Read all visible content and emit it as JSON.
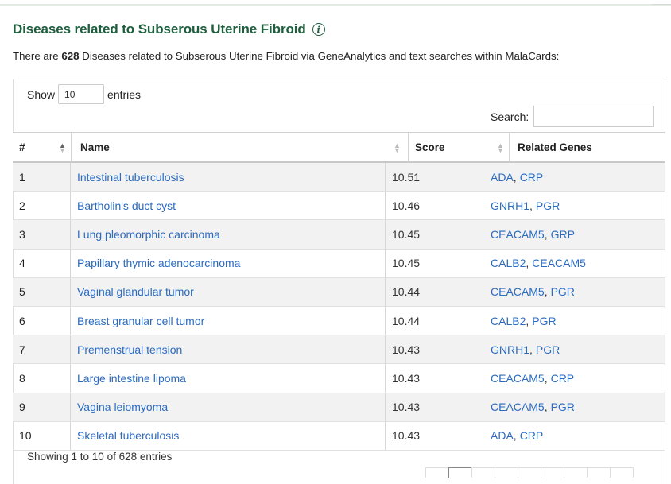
{
  "section": {
    "title": "Diseases related to Subserous Uterine Fibroid",
    "summary_pre": "There are ",
    "summary_count": "628",
    "summary_post": " Diseases related to Subserous Uterine Fibroid via GeneAnalytics and text searches within MalaCards:"
  },
  "controls": {
    "show_label": "Show",
    "entries_value": "10",
    "entries_label": "entries",
    "search_label": "Search:",
    "search_value": ""
  },
  "columns": [
    "#",
    "Name",
    "Score",
    "Related Genes"
  ],
  "rows": [
    {
      "num": "1",
      "name": "Intestinal tuberculosis",
      "score": "10.51",
      "genes": [
        "ADA",
        "CRP"
      ]
    },
    {
      "num": "2",
      "name": "Bartholin's duct cyst",
      "score": "10.46",
      "genes": [
        "GNRH1",
        "PGR"
      ]
    },
    {
      "num": "3",
      "name": "Lung pleomorphic carcinoma",
      "score": "10.45",
      "genes": [
        "CEACAM5",
        "GRP"
      ]
    },
    {
      "num": "4",
      "name": "Papillary thymic adenocarcinoma",
      "score": "10.45",
      "genes": [
        "CALB2",
        "CEACAM5"
      ]
    },
    {
      "num": "5",
      "name": "Vaginal glandular tumor",
      "score": "10.44",
      "genes": [
        "CEACAM5",
        "PGR"
      ]
    },
    {
      "num": "6",
      "name": "Breast granular cell tumor",
      "score": "10.44",
      "genes": [
        "CALB2",
        "PGR"
      ]
    },
    {
      "num": "7",
      "name": "Premenstrual tension",
      "score": "10.43",
      "genes": [
        "GNRH1",
        "PGR"
      ]
    },
    {
      "num": "8",
      "name": "Large intestine lipoma",
      "score": "10.43",
      "genes": [
        "CEACAM5",
        "CRP"
      ]
    },
    {
      "num": "9",
      "name": "Vagina leiomyoma",
      "score": "10.43",
      "genes": [
        "CEACAM5",
        "PGR"
      ]
    },
    {
      "num": "10",
      "name": "Skeletal tuberculosis",
      "score": "10.43",
      "genes": [
        "ADA",
        "CRP"
      ]
    }
  ],
  "footer": {
    "info": "Showing 1 to 10 of 628 entries"
  },
  "colors": {
    "title": "#1d5e3c",
    "link": "#2a6bc0",
    "row_stripe": "#f2f2f2"
  },
  "icons": {
    "info": "info-circle-icon",
    "sort": "sort-arrows-icon"
  }
}
